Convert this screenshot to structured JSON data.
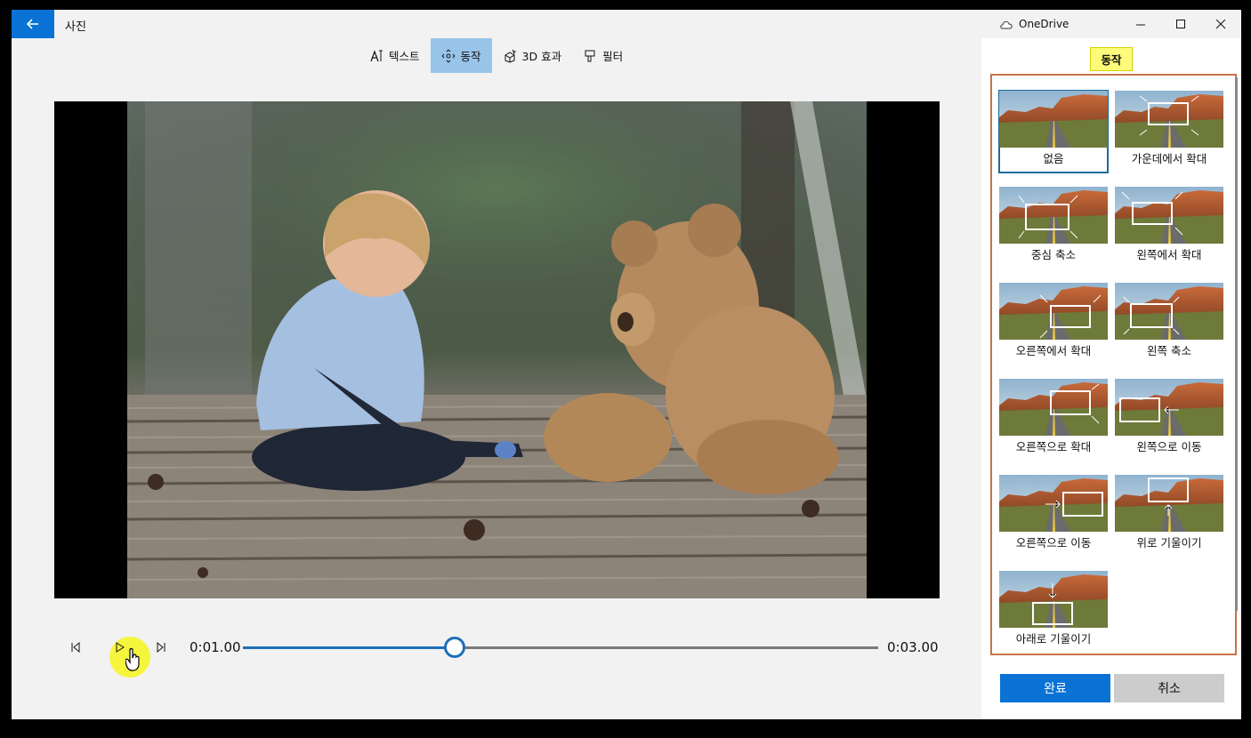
{
  "app": {
    "title": "사진",
    "onedrive_label": "OneDrive"
  },
  "toolbar": {
    "items": [
      {
        "label": "텍스트",
        "icon": "text-icon",
        "active": false
      },
      {
        "label": "동작",
        "icon": "motion-icon",
        "active": true
      },
      {
        "label": "3D 효과",
        "icon": "3d-effects-icon",
        "active": false
      },
      {
        "label": "필터",
        "icon": "filter-icon",
        "active": false
      }
    ]
  },
  "playback": {
    "current_time": "0:01.00",
    "total_time": "0:03.00",
    "progress": 0.333
  },
  "panel": {
    "title": "동작",
    "motions": [
      {
        "label": "없음",
        "selected": true
      },
      {
        "label": "가운데에서 확대",
        "selected": false
      },
      {
        "label": "중심 축소",
        "selected": false
      },
      {
        "label": "왼쪽에서 확대",
        "selected": false
      },
      {
        "label": "오른쪽에서 확대",
        "selected": false
      },
      {
        "label": "왼쪽 축소",
        "selected": false
      },
      {
        "label": "오른쪽으로 확대",
        "selected": false
      },
      {
        "label": "왼쪽으로 이동",
        "selected": false
      },
      {
        "label": "오른쪽으로 이동",
        "selected": false
      },
      {
        "label": "위로 기울이기",
        "selected": false
      },
      {
        "label": "아래로 기울이기",
        "selected": false
      }
    ],
    "done_label": "완료",
    "cancel_label": "취소"
  },
  "colors": {
    "accent": "#0a72d4",
    "toolbar_active": "#99c4ea",
    "highlight": "#fefb7a"
  }
}
